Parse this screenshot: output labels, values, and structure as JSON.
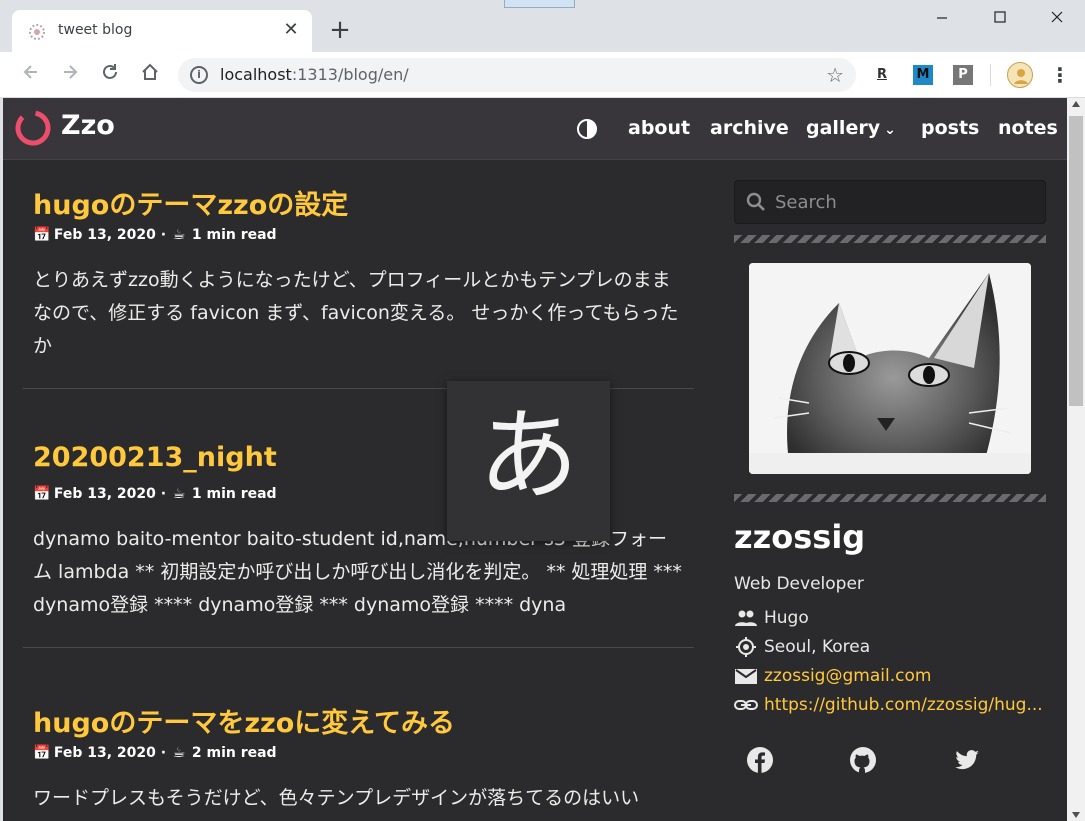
{
  "browser": {
    "tab_title": "tweet blog",
    "tab_close": "✕",
    "new_tab": "+",
    "url_host": "localhost",
    "url_path": ":1313/blog/en/",
    "extensions": [
      {
        "name": "R",
        "color": "#333333",
        "bg": "#ffffff"
      },
      {
        "name": "M",
        "color": "#ffffff",
        "bg": "#1e88c8"
      },
      {
        "name": "P",
        "color": "#ffffff",
        "bg": "#777777"
      }
    ]
  },
  "site": {
    "logo_text": "Zzo",
    "accent": "#ffc83d",
    "nav": [
      {
        "label": "about"
      },
      {
        "label": "archive"
      },
      {
        "label": "gallery"
      },
      {
        "label": "posts"
      },
      {
        "label": "notes"
      }
    ],
    "gallery_caret": "⌄"
  },
  "posts": [
    {
      "title": "hugoのテーマzzoの設定",
      "date": "Feb 13, 2020",
      "read": "1 min read",
      "summary": "とりあえずzzo動くようになったけど、プロフィールとかもテンプレのままなので、修正する favicon まず、favicon変える。 せっかく作ってもらったか"
    },
    {
      "title": "20200213_night",
      "date": "Feb 13, 2020",
      "read": "1 min read",
      "summary": "dynamo baito-mentor baito-student id,name,number s3 登録フォーム lambda ** 初期設定か呼び出しか呼び出し消化を判定。 ** 処理処理 *** dynamo登録 **** dynamo登録 *** dynamo登録 **** dyna"
    },
    {
      "title": "hugoのテーマをzzoに変えてみる",
      "date": "Feb 13, 2020",
      "read": "2 min read",
      "summary": "ワードプレスもそうだけど、色々テンプレデザインが落ちてるのはいい"
    }
  ],
  "meta_separator": "·",
  "ime_char": "あ",
  "sidebar": {
    "search_placeholder": "Search",
    "profile": {
      "name": "zzossig",
      "role": "Web Developer",
      "organization": "Hugo",
      "location": "Seoul, Korea",
      "email": "zzossig@gmail.com",
      "website": "https://github.com/zzossig/hug..."
    },
    "social": [
      "facebook-icon",
      "github-icon",
      "twitter-icon"
    ]
  }
}
